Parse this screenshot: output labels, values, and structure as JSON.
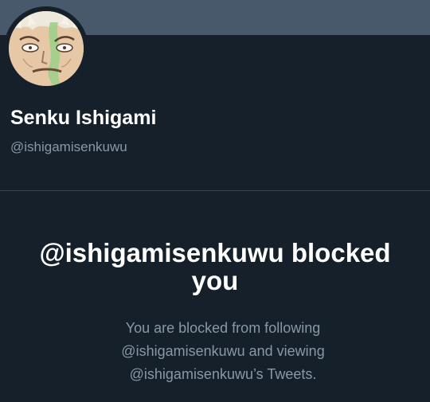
{
  "profile": {
    "display_name": "Senku Ishigami",
    "handle": "@ishigamisenkuwu",
    "avatar_icon": "anime-face-avatar"
  },
  "blocked": {
    "title_line1": "@ishigamisenkuwu blocked",
    "title_line2": "you",
    "message_line1": "You are blocked from following",
    "message_line2": "@ishigamisenkuwu and viewing",
    "message_line3": "@ishigamisenkuwu’s Tweets."
  },
  "colors": {
    "background": "#15202b",
    "banner": "#47596b",
    "divider": "#38444d",
    "primary_text": "#ffffff",
    "secondary_text": "#8899a6"
  }
}
